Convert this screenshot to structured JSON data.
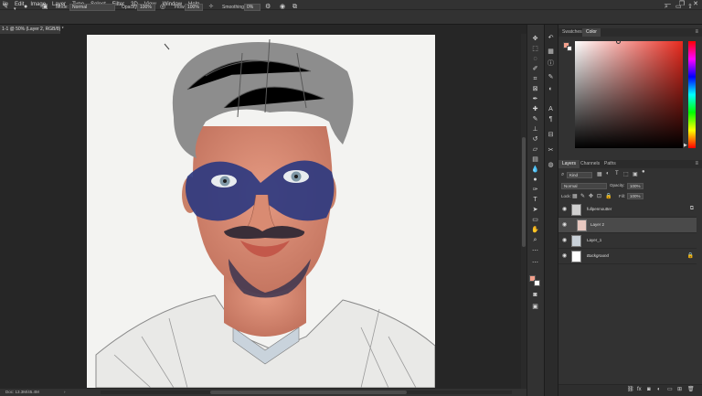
{
  "menu": {
    "items": [
      "ile",
      "Edit",
      "Image",
      "Layer",
      "Type",
      "Select",
      "Filter",
      "3D",
      "View",
      "Window",
      "Help"
    ]
  },
  "window_controls": [
    "—",
    "❐",
    "✕"
  ],
  "options": {
    "mode_label": "Mode:",
    "mode_value": "Normal",
    "opacity_label": "Opacity:",
    "opacity_value": "100%",
    "flow_label": "Flow:",
    "flow_value": "100%",
    "smoothing_label": "Smoothing:",
    "smoothing_value": "0%"
  },
  "document": {
    "tab_title": "1-1 @ 50% (Layer 2, RGB/8) *"
  },
  "status": {
    "doc_info": "Doc: 13.3M/45.4M"
  },
  "color_panel": {
    "tabs": [
      "Swatches",
      "Color"
    ],
    "active_tab": "Color",
    "foreground": "#f2a08c",
    "background": "#ffffff",
    "hue_color": "#e82a1e"
  },
  "layers_panel": {
    "tabs": [
      "Layers",
      "Channels",
      "Paths"
    ],
    "active_tab": "Layers",
    "filter_label": "Kind",
    "blend_mode": "Normal",
    "opacity_label": "Opacity:",
    "opacity_value": "100%",
    "lock_label": "Lock:",
    "fill_label": "Fill:",
    "fill_value": "100%",
    "layers": [
      {
        "name": "fullpennoutter",
        "selected": false
      },
      {
        "name": "Layer 2",
        "selected": true
      },
      {
        "name": "Layer_1",
        "selected": false
      },
      {
        "name": "Background",
        "selected": false
      }
    ]
  }
}
